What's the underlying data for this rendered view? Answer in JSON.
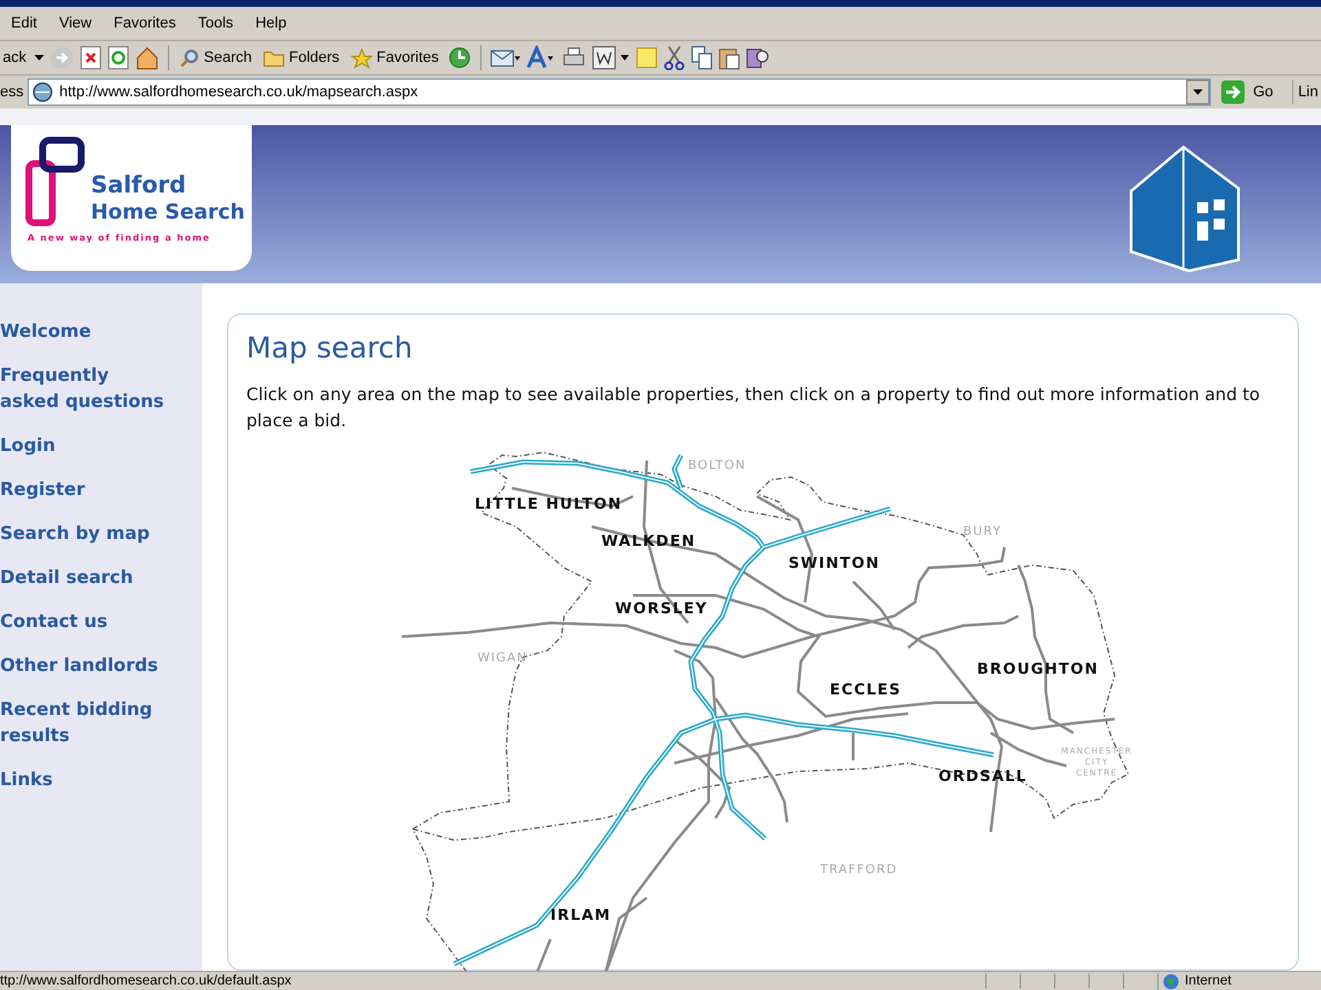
{
  "menu": [
    "Edit",
    "View",
    "Favorites",
    "Tools",
    "Help"
  ],
  "toolbar": {
    "back": "ack",
    "search": "Search",
    "folders": "Folders",
    "favorites": "Favorites"
  },
  "address": {
    "label": "ess",
    "url": "http://www.salfordhomesearch.co.uk/mapsearch.aspx",
    "go": "Go",
    "links": "Lin"
  },
  "site": {
    "logo_line_1": "Salford",
    "logo_line_2": "Home Search",
    "tagline": "A new way of finding a home"
  },
  "sidebar": {
    "items": [
      "Welcome",
      "Frequently asked questions",
      "Login",
      "Register",
      "Search by map",
      "Detail search",
      "Contact us",
      "Other landlords",
      "Recent bidding results",
      "Links"
    ]
  },
  "content": {
    "title": "Map search",
    "intro": "Click on any area on the map to see available properties, then click on a property to find out more information and to place a bid.",
    "map": {
      "towns": [
        "LITTLE HULTON",
        "WALKDEN",
        "SWINTON",
        "WORSLEY",
        "BROUGHTON",
        "ECCLES",
        "ORDSALL",
        "IRLAM"
      ],
      "neighbours": [
        "BOLTON",
        "BURY",
        "WIGAN",
        "TRAFFORD",
        "MANCHESTER",
        "CITY",
        "CENTRE"
      ]
    }
  },
  "status_bar": {
    "url": "ttp://www.salfordhomesearch.co.uk/default.aspx",
    "zone": "Internet"
  }
}
